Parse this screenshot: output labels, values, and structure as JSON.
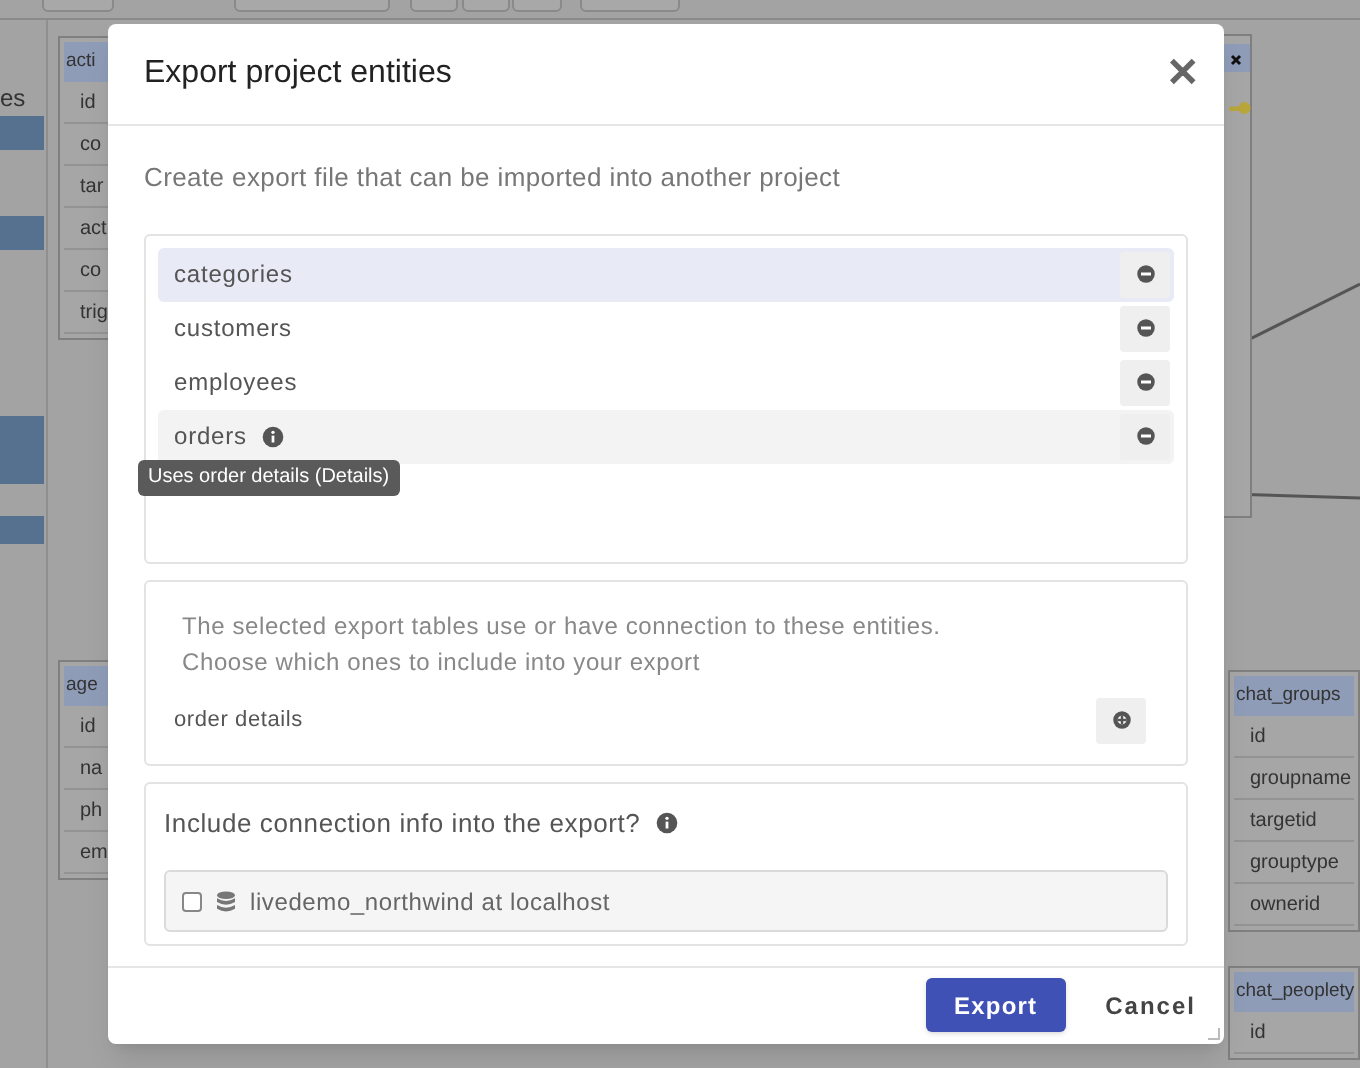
{
  "background": {
    "sidebar_label": "es",
    "tables": [
      {
        "title": "acti",
        "rows": [
          "id",
          "co",
          "tar",
          "act",
          "co",
          "trig"
        ]
      },
      {
        "title": "age",
        "rows": [
          "id",
          "na",
          "ph",
          "em"
        ]
      },
      {
        "title": "chat_groups",
        "rows": [
          "id",
          "groupname",
          "targetid",
          "grouptype",
          "ownerid"
        ]
      },
      {
        "title": "chat_peoplety",
        "rows": [
          "id"
        ]
      }
    ]
  },
  "dialog": {
    "title": "Export project entities",
    "close": "✕",
    "description": "Create export file that can be imported into another project",
    "entities": [
      {
        "name": "categories",
        "selected": true,
        "hovered": false,
        "info": false
      },
      {
        "name": "customers",
        "selected": false,
        "hovered": false,
        "info": false
      },
      {
        "name": "employees",
        "selected": false,
        "hovered": false,
        "info": false
      },
      {
        "name": "orders",
        "selected": false,
        "hovered": true,
        "info": true,
        "tooltip": "Uses order details (Details)"
      }
    ],
    "related": {
      "lines": [
        "The selected export tables use or have connection to these entities.",
        "Choose which ones to include into your export"
      ],
      "items": [
        {
          "name": "order details"
        }
      ]
    },
    "connection": {
      "heading": "Include connection info into the export?",
      "option": "livedemo_northwind at localhost",
      "checked": false
    },
    "buttons": [
      {
        "kind": "primary",
        "label": "Export"
      },
      {
        "kind": "text",
        "label": "Cancel"
      }
    ]
  }
}
